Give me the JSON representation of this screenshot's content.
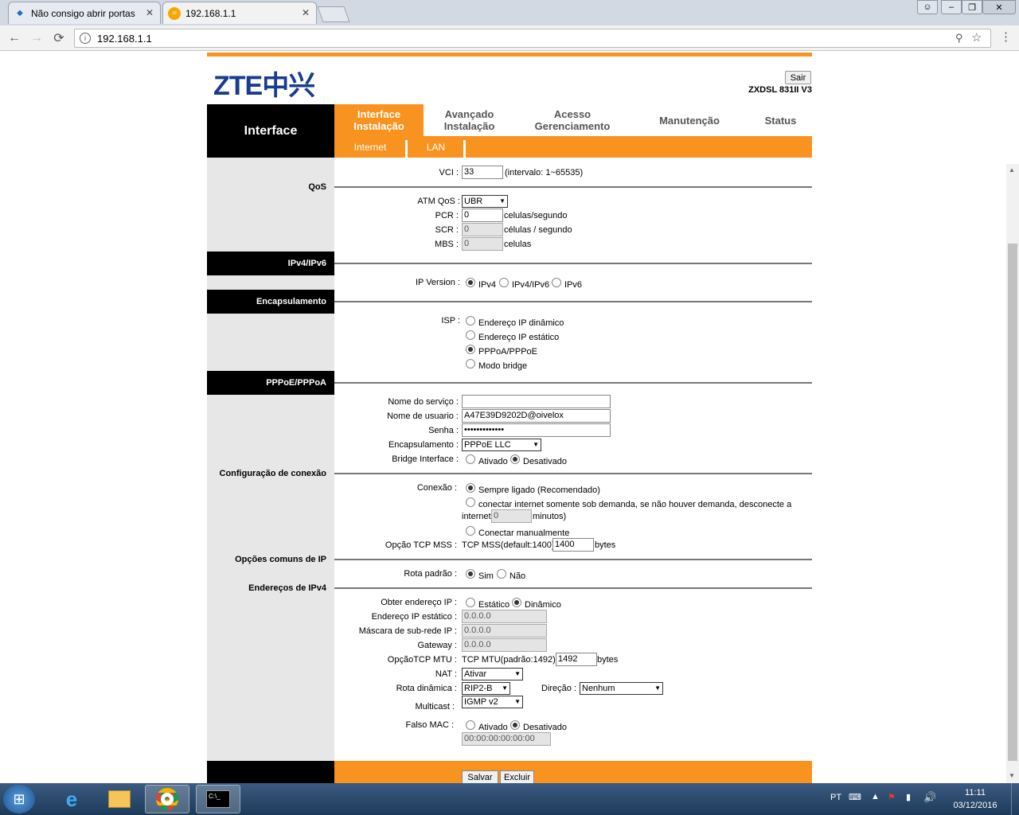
{
  "browser": {
    "tabs": [
      {
        "label": "Não consigo abrir portas"
      },
      {
        "label": "192.168.1.1"
      }
    ],
    "url": "192.168.1.1"
  },
  "page": {
    "sair": "Sair",
    "model": "ZXDSL 831II V3",
    "side_title": "Interface",
    "menu": [
      {
        "line1": "Interface",
        "line2": "Instalação"
      },
      {
        "line1": "Avançado",
        "line2": "Instalação"
      },
      {
        "line1": "Acesso",
        "line2": "Gerenciamento"
      },
      {
        "line1": "Manutenção",
        "line2": ""
      },
      {
        "line1": "Status",
        "line2": ""
      }
    ],
    "submenu": [
      "Internet",
      "LAN"
    ]
  },
  "sections": {
    "qos": "QoS",
    "ipv": "IPv4/IPv6",
    "encap": "Encapsulamento",
    "pppoe": "PPPoE/PPPoA",
    "conn": "Configuração de conexão",
    "ipopts": "Opções comuns de IP",
    "ipv4addr": "Endereços de IPv4"
  },
  "form": {
    "vci": {
      "label": "VCI :",
      "value": "33",
      "hint": "(intervalo: 1~65535)"
    },
    "atmqos": {
      "label": "ATM QoS :",
      "value": "UBR"
    },
    "pcr": {
      "label": "PCR :",
      "value": "0",
      "unit": "celulas/segundo"
    },
    "scr": {
      "label": "SCR :",
      "value": "0",
      "unit": "células / segundo"
    },
    "mbs": {
      "label": "MBS :",
      "value": "0",
      "unit": "celulas"
    },
    "ipversion": {
      "label": "IP Version :",
      "opts": [
        "IPv4",
        "IPv4/IPv6",
        "IPv6"
      ]
    },
    "isp": {
      "label": "ISP :",
      "opts": [
        "Endereço IP dinâmico",
        "Endereço IP estático",
        "PPPoA/PPPoE",
        "Modo bridge"
      ]
    },
    "servico": {
      "label": "Nome do serviço :",
      "value": ""
    },
    "usuario": {
      "label": "Nome de usuario :",
      "value": "A47E39D9202D@oivelox"
    },
    "senha": {
      "label": "Senha :",
      "value": "•••••••••••••"
    },
    "encap": {
      "label": "Encapsulamento :",
      "value": "PPPoE LLC"
    },
    "bridge": {
      "label": "Bridge Interface :",
      "opts": [
        "Ativado",
        "Desativado"
      ]
    },
    "conexao": {
      "label": "Conexão :",
      "opt1": "Sempre ligado (Recomendado)",
      "opt2a": "conectar internet somente sob demanda, se não houver demanda, desconecte a",
      "opt2b": "internet",
      "opt2val": "0",
      "opt2c": "minutos)",
      "opt3": "Conectar manualmente"
    },
    "mss": {
      "label": "Opção TCP MSS :",
      "prefix": "TCP MSS(default:1400)",
      "value": "1400",
      "unit": "bytes"
    },
    "rota": {
      "label": "Rota padrão :",
      "opts": [
        "Sim",
        "Não"
      ]
    },
    "obter": {
      "label": "Obter endereço IP :",
      "opts": [
        "Estático",
        "Dinâmico"
      ]
    },
    "ipest": {
      "label": "Endereço IP estático :",
      "value": "0.0.0.0"
    },
    "mask": {
      "label": "Máscara de sub-rede IP :",
      "value": "0.0.0.0"
    },
    "gw": {
      "label": "Gateway :",
      "value": "0.0.0.0"
    },
    "mtu": {
      "label": "OpçãoTCP MTU :",
      "prefix": "TCP MTU(padrão:1492)",
      "value": "1492",
      "unit": "bytes"
    },
    "nat": {
      "label": "NAT :",
      "value": "Ativar"
    },
    "rotadin": {
      "label": "Rota dinâmica :",
      "value": "RIP2-B",
      "dir_label": "Direção :",
      "dir_value": "Nenhum"
    },
    "multicast": {
      "label": "Multicast :",
      "value": "IGMP v2"
    },
    "mac": {
      "label": "Falso MAC :",
      "opts": [
        "Ativado",
        "Desativado"
      ],
      "value": "00:00:00:00:00:00"
    },
    "salvar": "Salvar",
    "excluir": "Excluir"
  },
  "taskbar": {
    "lang": "PT",
    "time": "11:11",
    "date": "03/12/2016"
  }
}
